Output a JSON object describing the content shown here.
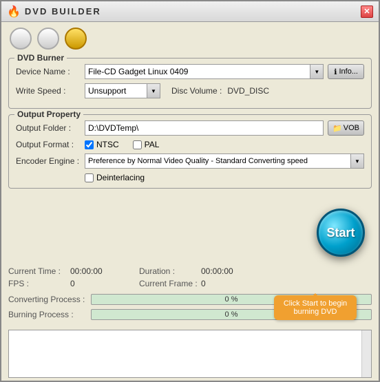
{
  "window": {
    "title": "DVD BUILDER",
    "title_icon": "🔥",
    "close_label": "✕"
  },
  "toolbar": {
    "btn1_label": "",
    "btn2_label": "",
    "btn3_label": ""
  },
  "dvd_burner": {
    "section_label": "DVD Burner",
    "device_label": "Device Name :",
    "device_value": "File-CD Gadget  Linux   0409",
    "info_label": "Info...",
    "write_speed_label": "Write Speed :",
    "write_speed_value": "Unsupport",
    "disc_volume_label": "Disc Volume :",
    "disc_volume_value": "DVD_DISC"
  },
  "output_property": {
    "section_label": "Output Property",
    "output_folder_label": "Output Folder :",
    "output_folder_value": "D:\\DVDTemp\\",
    "vob_label": "VOB",
    "output_format_label": "Output Format :",
    "ntsc_label": "NTSC",
    "ntsc_checked": true,
    "pal_label": "PAL",
    "pal_checked": false,
    "encoder_label": "Encoder Engine :",
    "encoder_value": "Preference by Normal Video Quality - Standard Converting speed",
    "deinterlace_label": "Deinterlacing",
    "deinterlace_checked": false
  },
  "stats": {
    "current_time_label": "Current Time :",
    "current_time_value": "00:00:00",
    "duration_label": "Duration :",
    "duration_value": "00:00:00",
    "fps_label": "FPS :",
    "fps_value": "0",
    "current_frame_label": "Current Frame :",
    "current_frame_value": "0"
  },
  "progress": {
    "converting_label": "Converting Process :",
    "converting_pct": "0 %",
    "converting_fill": 0,
    "burning_label": "Burning Process :",
    "burning_pct": "0 %",
    "burning_fill": 0
  },
  "start_button": {
    "label": "Start"
  },
  "tooltip": {
    "text": "Click Start to begin burning DVD"
  },
  "log": {
    "content": ""
  }
}
